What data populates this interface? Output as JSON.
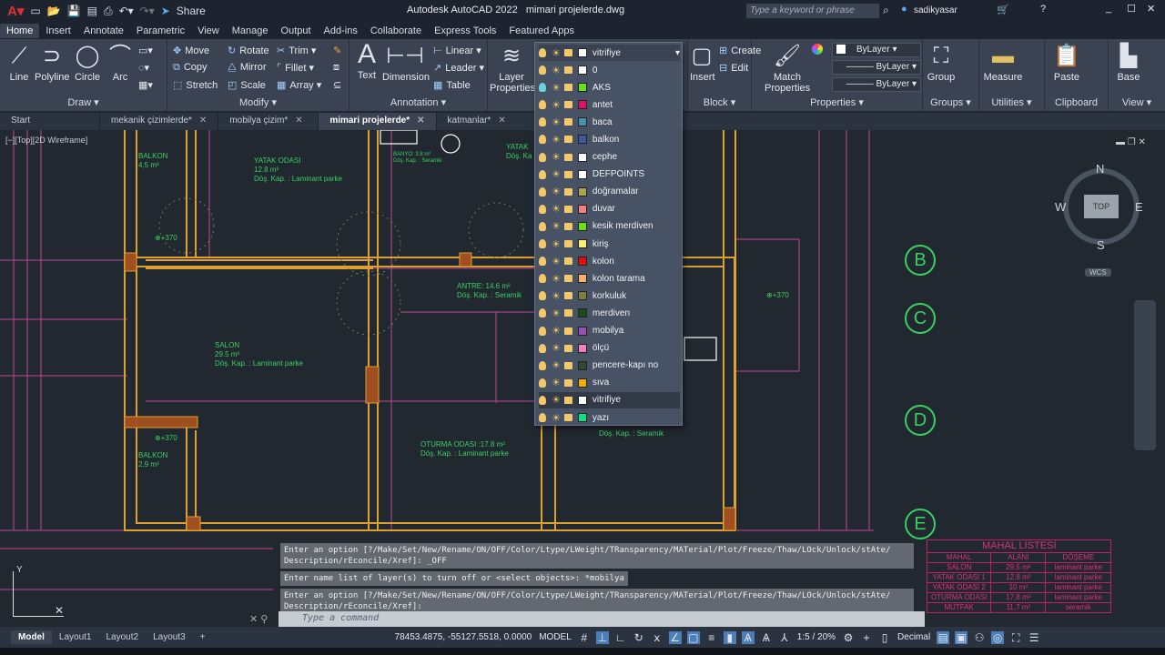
{
  "app": {
    "title": "Autodesk AutoCAD 2022",
    "file": "mimari projelerde.dwg",
    "share": "Share",
    "search_placeholder": "Type a keyword or phrase",
    "user": "sadikyasar"
  },
  "ribbon_tabs": [
    "Home",
    "Insert",
    "Annotate",
    "Parametric",
    "View",
    "Manage",
    "Output",
    "Add-ins",
    "Collaborate",
    "Express Tools",
    "Featured Apps"
  ],
  "panels": {
    "draw": {
      "title": "Draw",
      "line": "Line",
      "polyline": "Polyline",
      "circle": "Circle",
      "arc": "Arc"
    },
    "modify": {
      "title": "Modify",
      "move": "Move",
      "rotate": "Rotate",
      "trim": "Trim",
      "copy": "Copy",
      "mirror": "Mirror",
      "fillet": "Fillet",
      "stretch": "Stretch",
      "scale": "Scale",
      "array": "Array"
    },
    "annotation": {
      "title": "Annotation",
      "text": "Text",
      "dimension": "Dimension",
      "linear": "Linear",
      "leader": "Leader",
      "table": "Table"
    },
    "layers": {
      "layer_properties": "Layer Properties",
      "current": "vitrifiye"
    },
    "block": {
      "title": "Block",
      "insert": "Insert",
      "create": "Create",
      "edit": "Edit"
    },
    "properties": {
      "title": "Properties",
      "match": "Match Properties",
      "color": "ByLayer",
      "linetype": "ByLayer",
      "lineweight": "ByLayer"
    },
    "groups": {
      "title": "Groups",
      "group": "Group"
    },
    "utilities": {
      "title": "Utilities",
      "measure": "Measure"
    },
    "clipboard": {
      "title": "Clipboard",
      "paste": "Paste"
    },
    "view": {
      "title": "View",
      "base": "Base"
    }
  },
  "file_tabs": [
    {
      "label": "Start"
    },
    {
      "label": "mekanik çizimlerde*"
    },
    {
      "label": "mobilya çizim*"
    },
    {
      "label": "mimari projelerde*"
    },
    {
      "label": "katmanlar*"
    }
  ],
  "viewport_label": "[−][Top][2D Wireframe]",
  "layers": [
    {
      "name": "0",
      "color": "#ffffff"
    },
    {
      "name": "AKS",
      "color": "#66e01a"
    },
    {
      "name": "antet",
      "color": "#e0106a"
    },
    {
      "name": "baca",
      "color": "#4a90a8"
    },
    {
      "name": "balkon",
      "color": "#3e5a9a"
    },
    {
      "name": "cephe",
      "color": "#ffffff"
    },
    {
      "name": "DEFPOINTS",
      "color": "#ffffff"
    },
    {
      "name": "doğramalar",
      "color": "#a8a450"
    },
    {
      "name": "duvar",
      "color": "#f08080"
    },
    {
      "name": "kesik merdiven",
      "color": "#66e01a"
    },
    {
      "name": "kiriş",
      "color": "#f8f070"
    },
    {
      "name": "kolon",
      "color": "#e01010"
    },
    {
      "name": "kolon tarama",
      "color": "#f8b070"
    },
    {
      "name": "korkuluk",
      "color": "#7e7e40"
    },
    {
      "name": "merdiven",
      "color": "#1a4a1a"
    },
    {
      "name": "mobilya",
      "color": "#9a50b0"
    },
    {
      "name": "ölçü",
      "color": "#f080c0"
    },
    {
      "name": "pencere-kapı no",
      "color": "#2e4a2e"
    },
    {
      "name": "sıva",
      "color": "#f0b000"
    },
    {
      "name": "vitrifiye",
      "color": "#ffffff"
    },
    {
      "name": "yazı",
      "color": "#10e080"
    }
  ],
  "drawing": {
    "rooms": [
      {
        "name": "BALKON",
        "area": "4,5 m²"
      },
      {
        "name": "YATAK ODASI",
        "area": "12.8 m²",
        "floor": "Döş. Kap. : Laminant parke"
      },
      {
        "name": "BANYO: 3.8 m²",
        "floor": "Döş. Kap. : Seramik"
      },
      {
        "name": "ANTRE: 14.6 m²",
        "floor": "Döş. Kap. : Seramik"
      },
      {
        "name": "SALON",
        "area": "29.5 m²",
        "floor": "Döş. Kap. : Laminant parke"
      },
      {
        "name": "OTURMA ODASI :17.8 m²",
        "floor": "Döş. Kap. : Laminant parke"
      },
      {
        "name": "BALKON",
        "area": "2,9 m²"
      },
      {
        "name": "YATAK",
        "floor": "Döş. Ka"
      },
      {
        "floor": "Döş. Kap. : Seramik"
      }
    ],
    "levels": [
      "+370",
      "+370",
      "+370"
    ],
    "axis_bubbles": [
      "B",
      "C",
      "D",
      "E"
    ],
    "compass": {
      "n": "N",
      "s": "S",
      "e": "E",
      "w": "W",
      "top": "TOP",
      "wcs": "WCS"
    },
    "mahal": {
      "title": "MAHAL LİSTESİ",
      "headers": [
        "MAHAL",
        "ALANI",
        "DÖŞEME"
      ],
      "rows": [
        [
          "SALON",
          "29,5 m²",
          "laminant parke"
        ],
        [
          "YATAK ODASI 1",
          "12,8 m²",
          "laminant parke"
        ],
        [
          "YATAK ODASI 2",
          "10 m²",
          "laminant parke"
        ],
        [
          "OTURMA ODASI",
          "17,8 m²",
          "laminant parke"
        ],
        [
          "MUTFAK",
          "11,7 m²",
          "seramik"
        ]
      ]
    }
  },
  "command": {
    "history": [
      "Enter an option [?/Make/Set/New/Rename/ON/OFF/Color/Ltype/LWeight/TRansparency/MATerial/Plot/Freeze/Thaw/LOck/Unlock/stAte/ Description/rEconcile/Xref]: _OFF",
      "Enter name list of layer(s) to turn off or <select objects>: *mobilya",
      "Enter an option [?/Make/Set/New/Rename/ON/OFF/Color/Ltype/LWeight/TRansparency/MATerial/Plot/Freeze/Thaw/LOck/Unlock/stAte/ Description/rEconcile/Xref]:"
    ],
    "placeholder": "Type a command"
  },
  "status": {
    "layout_tabs": [
      "Model",
      "Layout1",
      "Layout2",
      "Layout3"
    ],
    "coords": "78453.4875, -55127.5518, 0.0000",
    "model": "MODEL",
    "scale": "1:5 / 20%",
    "units": "Decimal"
  }
}
